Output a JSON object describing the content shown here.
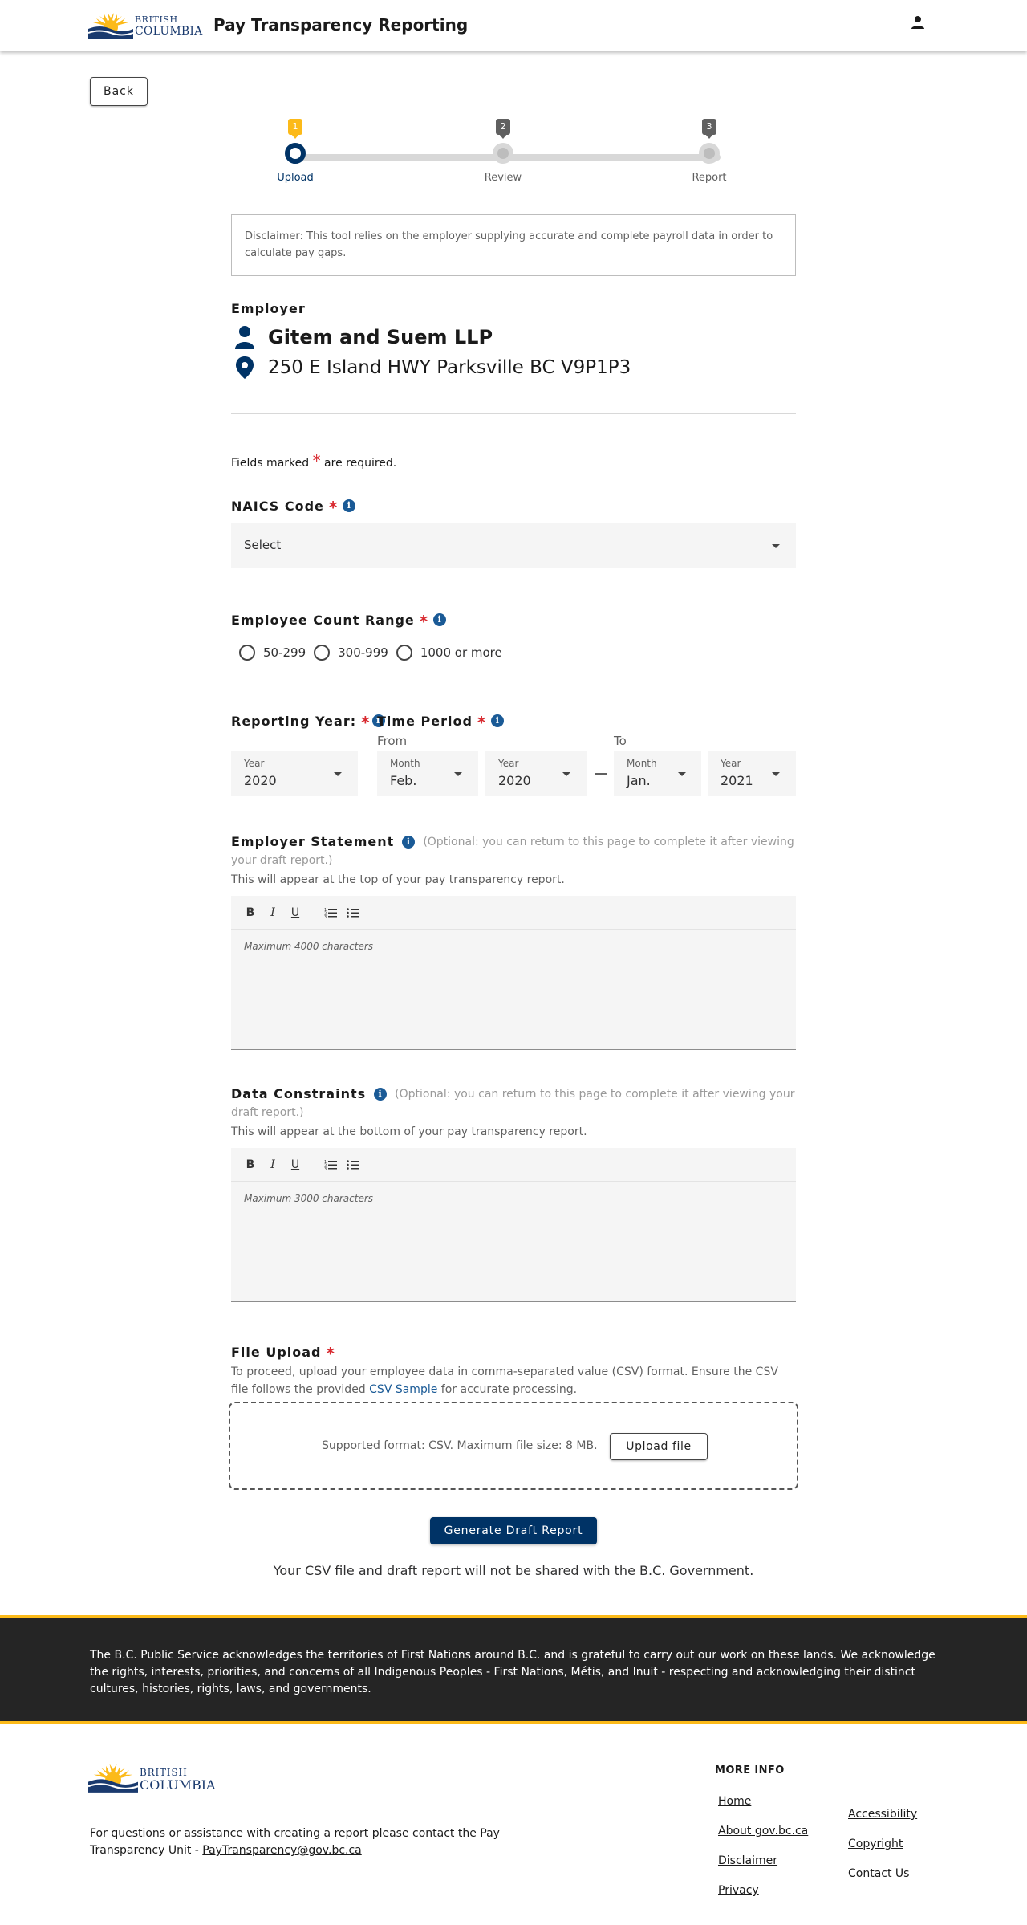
{
  "header": {
    "logo_line1": "BRITISH",
    "logo_line2": "COLUMBIA",
    "app_title": "Pay Transparency Reporting"
  },
  "back_label": "Back",
  "stepper": [
    {
      "num": "1",
      "label": "Upload",
      "state": "active"
    },
    {
      "num": "2",
      "label": "Review",
      "state": "idle"
    },
    {
      "num": "3",
      "label": "Report",
      "state": "idle"
    }
  ],
  "disclaimer": "Disclaimer: This tool relies on the employer supplying accurate and complete payroll data in order to calculate pay gaps.",
  "employer": {
    "heading": "Employer",
    "name": "Gitem and Suem LLP",
    "address": "250 E Island HWY Parksville BC V9P1P3"
  },
  "required_note": {
    "before": "Fields marked",
    "star": "*",
    "after": "are required."
  },
  "naics": {
    "label": "NAICS Code",
    "value": "Select"
  },
  "employee_count": {
    "label": "Employee Count Range",
    "options": [
      "50-299",
      "300-999",
      "1000 or more"
    ]
  },
  "reporting_year": {
    "label": "Reporting Year:",
    "caption": "Year",
    "value": "2020"
  },
  "time_period": {
    "label": "Time Period",
    "from_label": "From",
    "to_label": "To",
    "from_month_caption": "Month",
    "from_month": "Feb.",
    "from_year_caption": "Year",
    "from_year": "2020",
    "to_month_caption": "Month",
    "to_month": "Jan.",
    "to_year_caption": "Year",
    "to_year": "2021"
  },
  "employer_statement": {
    "label": "Employer Statement",
    "optional": "(Optional: you can return to this page to complete it after viewing",
    "optional2": "your draft report.)",
    "note": "This will appear at the top of your pay transparency report.",
    "placeholder": "Maximum 4000 characters"
  },
  "data_constraints": {
    "label": "Data Constraints",
    "optional": "(Optional: you can return to this page to complete it after viewing your",
    "optional2": "draft report.)",
    "note": "This will appear at the bottom of your pay transparency report.",
    "placeholder": "Maximum 3000 characters"
  },
  "toolbar": {
    "bold": "B",
    "italic": "I",
    "underline": "U"
  },
  "file_upload": {
    "label": "File Upload",
    "desc1": "To proceed, upload your employee data in comma-separated value (CSV) format. Ensure the CSV",
    "desc2_before": "file follows the provided ",
    "desc2_link": "CSV Sample",
    "desc2_after": " for accurate processing.",
    "supported": "Supported format: CSV. Maximum file size: 8 MB.",
    "button": "Upload file"
  },
  "generate_button": "Generate Draft Report",
  "share_note": "Your CSV file and draft report will not be shared with the B.C. Government.",
  "footer": {
    "acknowledgement": "The B.C. Public Service acknowledges the territories of First Nations around B.C. and is grateful to carry out our work on these lands. We acknowledge the rights, interests, priorities, and concerns of all Indigenous Peoples - First Nations, Métis, and Inuit - respecting and acknowledging their distinct cultures, histories, rights, laws, and governments.",
    "contact_before": "For questions or assistance with creating a report please contact the Pay Transparency Unit - ",
    "contact_email": "PayTransparency@gov.bc.ca",
    "more_info": "MORE INFO",
    "links_col1": [
      "Home",
      "About gov.bc.ca",
      "Disclaimer",
      "Privacy"
    ],
    "links_col2": [
      "Accessibility",
      "Copyright",
      "Contact Us"
    ]
  },
  "colors": {
    "primary": "#003366",
    "accent": "#fcba19",
    "required": "#d8292f",
    "info": "#1a5a96"
  }
}
